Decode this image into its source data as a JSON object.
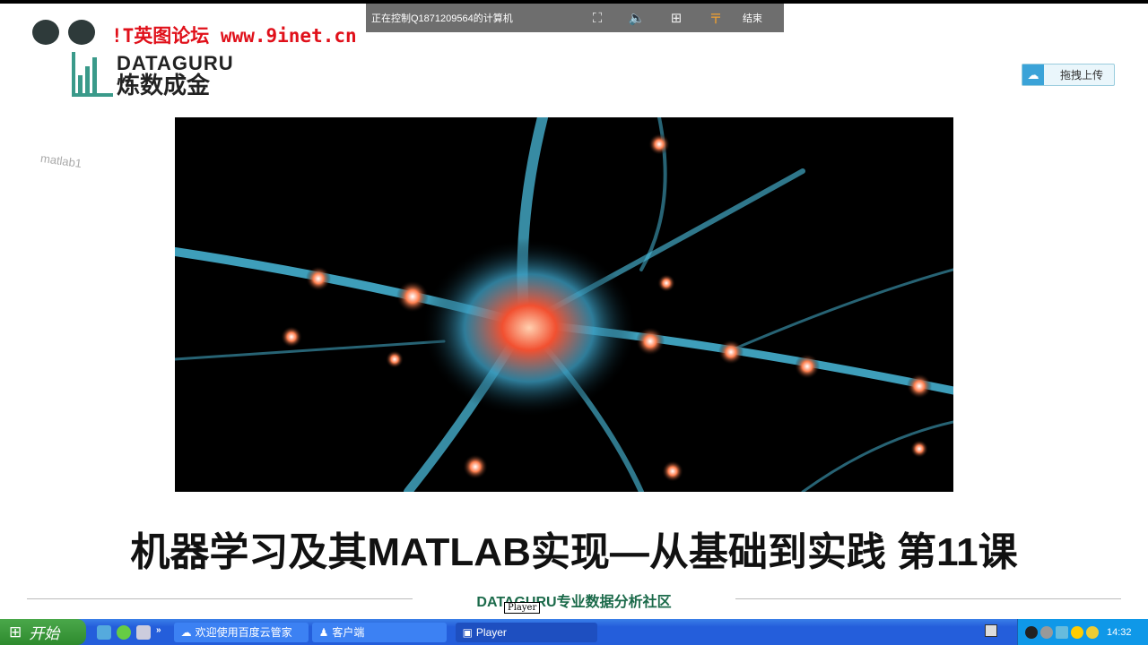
{
  "remote_bar": {
    "title": "正在控制Q1871209564的计算机",
    "end_label": "结束"
  },
  "watermark": {
    "text": "!T英图论坛 www.9inet.cn"
  },
  "logo": {
    "en": "DATAGURU",
    "cn": "炼数成金"
  },
  "upload_button": {
    "label": "拖拽上传"
  },
  "side_label": "matlab1",
  "slide": {
    "title": "机器学习及其MATLAB实现—从基础到实践 第11课",
    "footer": "DATAGURU专业数据分析社区"
  },
  "tooltip": "Player",
  "taskbar": {
    "start_label": "开始",
    "tasks": [
      {
        "label": "欢迎使用百度云管家"
      },
      {
        "label": "客户端"
      },
      {
        "label": "Player"
      }
    ],
    "clock": "14:32"
  }
}
